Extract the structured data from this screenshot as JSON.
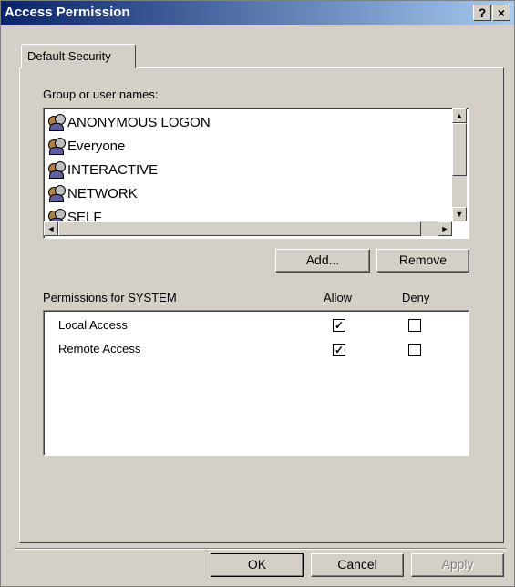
{
  "window": {
    "title": "Access Permission",
    "help_label": "?",
    "close_label": "×"
  },
  "tabs": [
    {
      "label": "Default Security"
    }
  ],
  "group_section": {
    "label": "Group or user names:",
    "items": [
      {
        "label": "ANONYMOUS LOGON"
      },
      {
        "label": "Everyone"
      },
      {
        "label": "INTERACTIVE"
      },
      {
        "label": "NETWORK"
      },
      {
        "label": "SELF"
      }
    ],
    "add_label": "Add...",
    "remove_label": "Remove"
  },
  "permissions": {
    "header": "Permissions for SYSTEM",
    "allow_label": "Allow",
    "deny_label": "Deny",
    "rows": [
      {
        "label": "Local Access",
        "allow": true,
        "deny": false
      },
      {
        "label": "Remote Access",
        "allow": true,
        "deny": false
      }
    ]
  },
  "footer": {
    "ok_label": "OK",
    "cancel_label": "Cancel",
    "apply_label": "Apply"
  },
  "colors": {
    "title_start": "#0a246a",
    "title_end": "#a6caf0",
    "face": "#d4d0c8"
  },
  "icons": {
    "user": "group-user-icon"
  }
}
